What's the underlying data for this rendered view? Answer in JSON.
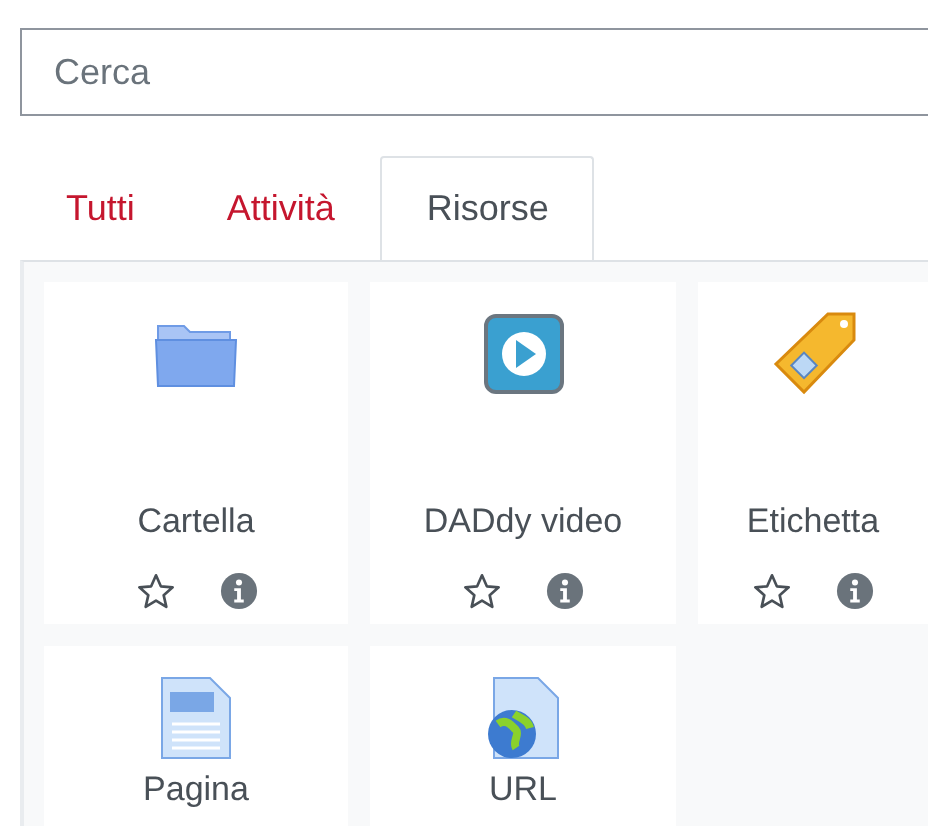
{
  "search": {
    "placeholder": "Cerca"
  },
  "tabs": [
    {
      "label": "Tutti",
      "selected": false
    },
    {
      "label": "Attività",
      "selected": false
    },
    {
      "label": "Risorse",
      "selected": true
    }
  ],
  "modules": [
    {
      "kind": "folder",
      "name": "Cartella",
      "starred": false
    },
    {
      "kind": "video",
      "name": "DADdy video",
      "starred": false
    },
    {
      "kind": "label",
      "name": "Etichetta",
      "starred": false
    },
    {
      "kind": "page",
      "name": "Pagina"
    },
    {
      "kind": "url",
      "name": "URL"
    }
  ]
}
